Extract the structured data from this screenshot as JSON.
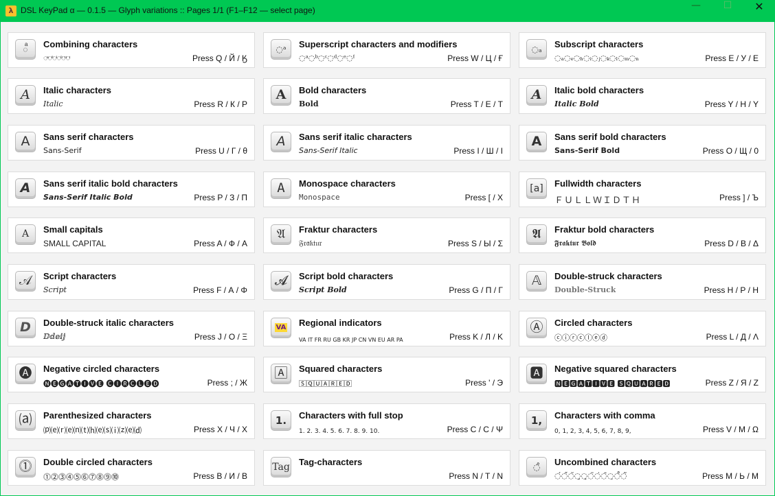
{
  "window": {
    "title": "DSL KeyPad α — 0.1.5 — Glyph variations   ::   Pages 1/1 (F1–F12 — select page)",
    "accent_color": "#00c853"
  },
  "cards": [
    {
      "title": "Combining characters",
      "sample": "◌ͣ◌ͤ◌ͥ◌ͦ◌ͧ◌ͨ",
      "key": "Press Q / Й / Ӄ",
      "icon": "◌ͣ"
    },
    {
      "title": "Superscript characters and modifiers",
      "sample": "◌ᵃ◌ᵇ◌ᶜ◌ᵈ◌ᵉ◌ᶠ",
      "key": "Press W / Ц / Ғ",
      "icon": "◌ᵃ"
    },
    {
      "title": "Subscript characters",
      "sample": "◌ₐ◌ₑ◌ₕ◌ᵢ◌ⱼ◌ₖ◌ₗ◌ₘ◌ₙ",
      "key": "Press E / У / Е",
      "icon": "◌ₐ"
    },
    {
      "title": "Italic characters",
      "sample": "Italic",
      "key": "Press R / К / Р",
      "icon": "A"
    },
    {
      "title": "Bold characters",
      "sample": "Bold",
      "key": "Press T / Е / Т",
      "icon": "A"
    },
    {
      "title": "Italic bold characters",
      "sample": "Italic Bold",
      "key": "Press Y / Н / Y",
      "icon": "A"
    },
    {
      "title": "Sans serif characters",
      "sample": "Sans-Serif",
      "key": "Press U / Г / θ",
      "icon": "A"
    },
    {
      "title": "Sans serif italic characters",
      "sample": "Sans-Serif Italic",
      "key": "Press I / Ш / I",
      "icon": "A"
    },
    {
      "title": "Sans serif bold characters",
      "sample": "Sans-Serif Bold",
      "key": "Press O / Щ / 0",
      "icon": "A"
    },
    {
      "title": "Sans serif italic bold characters",
      "sample": "Sans-Serif Italic Bold",
      "key": "Press P / З / П",
      "icon": "A"
    },
    {
      "title": "Monospace characters",
      "sample": "Monospace",
      "key": "Press [ / Х",
      "icon": "A"
    },
    {
      "title": "Fullwidth characters",
      "sample": "ＦＵＬＬＷＩＤＴＨ",
      "key": "Press ] / Ъ",
      "icon": "[a]"
    },
    {
      "title": "Small capitals",
      "sample": "SMALL CAPITAL",
      "key": "Press A / Ф / A",
      "icon": "A"
    },
    {
      "title": "Fraktur characters",
      "sample": "𝔉𝔯𝔞𝔨𝔱𝔲𝔯",
      "key": "Press S / Ы / Σ",
      "icon": "𝔄"
    },
    {
      "title": "Fraktur bold characters",
      "sample": "𝕱𝖗𝖆𝖐𝖙𝖚𝖗 𝕭𝖔𝖑𝖉",
      "key": "Press D / В / Δ",
      "icon": "𝕬"
    },
    {
      "title": "Script characters",
      "sample": "Script",
      "key": "Press F / А / Φ",
      "icon": "𝒜"
    },
    {
      "title": "Script bold characters",
      "sample": "Script Bold",
      "key": "Press G / П / Γ",
      "icon": "𝓐"
    },
    {
      "title": "Double-struck characters",
      "sample": "Double-Struck",
      "key": "Press H / Р / H",
      "icon": "𝔸"
    },
    {
      "title": "Double-struck italic characters",
      "sample": "ⅅⅆⅇⅈⅉ",
      "key": "Press J / О / Ξ",
      "icon": "D"
    },
    {
      "title": "Regional indicators",
      "sample": "VA IT FR RU GB KR JP CN VN EU AR PA",
      "key": "Press K / Л / K",
      "icon": "VA"
    },
    {
      "title": "Circled characters",
      "sample": "ⓒⓘⓡⓒⓛⓔⓓ",
      "key": "Press L / Д / Λ",
      "icon": "Ⓐ"
    },
    {
      "title": "Negative circled characters",
      "sample": "🅝🅔🅖🅐🅣🅘🅥🅔 🅒🅘🅡🅒🅛🅔🅓",
      "key": "Press ; / Ж",
      "icon": "🅐"
    },
    {
      "title": "Squared characters",
      "sample": "🅂🅀🅄🄰🅁🄴🄳",
      "key": "Press ' / Э",
      "icon": "🄰"
    },
    {
      "title": "Negative squared characters",
      "sample": "🅽🅴🅶🅰🆃🅸🆅🅴 🆂🆀🆄🅰🆁🅴🅳",
      "key": "Press Z / Я / Z",
      "icon": "🅰"
    },
    {
      "title": "Parenthesized characters",
      "sample": "⒫⒠⒭⒠⒩⒯⒣⒠⒮⒤⒵⒠⒟",
      "key": "Press X / Ч / X",
      "icon": "⒜"
    },
    {
      "title": "Characters with full stop",
      "sample": "1.  2.  3.  4.  5.  6.  7.  8.  9.  10.",
      "key": "Press C / C / Ψ",
      "icon": "1."
    },
    {
      "title": "Characters with comma",
      "sample": "0,  1,  2,  3,  4,  5,  6,  7,  8,  9,",
      "key": "Press V / М / Ω",
      "icon": "1,"
    },
    {
      "title": "Double circled characters",
      "sample": "⓵⓶⓷⓸⓹⓺⓻⓼⓽⓾",
      "key": "Press B / И / B",
      "icon": "⓵"
    },
    {
      "title": "Tag-characters",
      "sample": "",
      "key": "Press N / Т / N",
      "icon": "Tag"
    },
    {
      "title": "Uncombined characters",
      "sample": "◌́◌̋◌̆◌̧◌̨◌̈◌̇◌̄◌̣◌̊◌̃",
      "key": "Press M / Ь / M",
      "icon": "◌̊"
    }
  ]
}
